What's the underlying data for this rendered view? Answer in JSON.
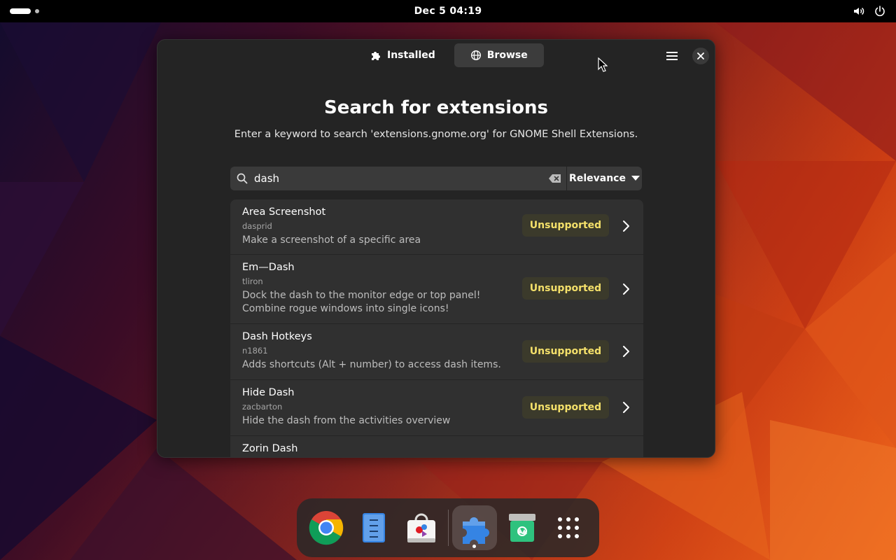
{
  "topbar": {
    "clock": "Dec 5  04:19"
  },
  "window": {
    "tabs": [
      {
        "label": "Installed",
        "icon": "puzzle-icon",
        "active": false
      },
      {
        "label": "Browse",
        "icon": "globe-icon",
        "active": true
      }
    ],
    "title": "Search for extensions",
    "subtitle": "Enter a keyword to search 'extensions.gnome.org' for GNOME Shell Extensions.",
    "search": {
      "value": "dash",
      "placeholder": ""
    },
    "sort": {
      "selected": "Relevance"
    },
    "results": [
      {
        "name": "Area Screenshot",
        "author": "dasprid",
        "description": "Make a screenshot of a specific area",
        "status": "Unsupported"
      },
      {
        "name": "Em—Dash",
        "author": "tliron",
        "description": "Dock the dash to the monitor edge or top panel! Combine rogue windows into single icons!",
        "status": "Unsupported"
      },
      {
        "name": "Dash Hotkeys",
        "author": "n1861",
        "description": "Adds shortcuts (Alt + number) to access dash items.",
        "status": "Unsupported"
      },
      {
        "name": "Hide Dash",
        "author": "zacbarton",
        "description": "Hide the dash from the activities overview",
        "status": "Unsupported"
      },
      {
        "name": "Zorin Dash",
        "author": "",
        "description": "",
        "status": ""
      }
    ]
  },
  "dock": {
    "apps": [
      {
        "icon": "chrome-icon"
      },
      {
        "icon": "text-editor-icon"
      },
      {
        "icon": "software-store-icon"
      },
      {
        "icon": "extension-manager-icon",
        "running": true
      },
      {
        "icon": "trash-icon"
      },
      {
        "icon": "app-grid-icon"
      }
    ]
  },
  "colors": {
    "accent_warning": "#f4e06a",
    "window_bg": "#242424",
    "row_bg": "#303030"
  }
}
